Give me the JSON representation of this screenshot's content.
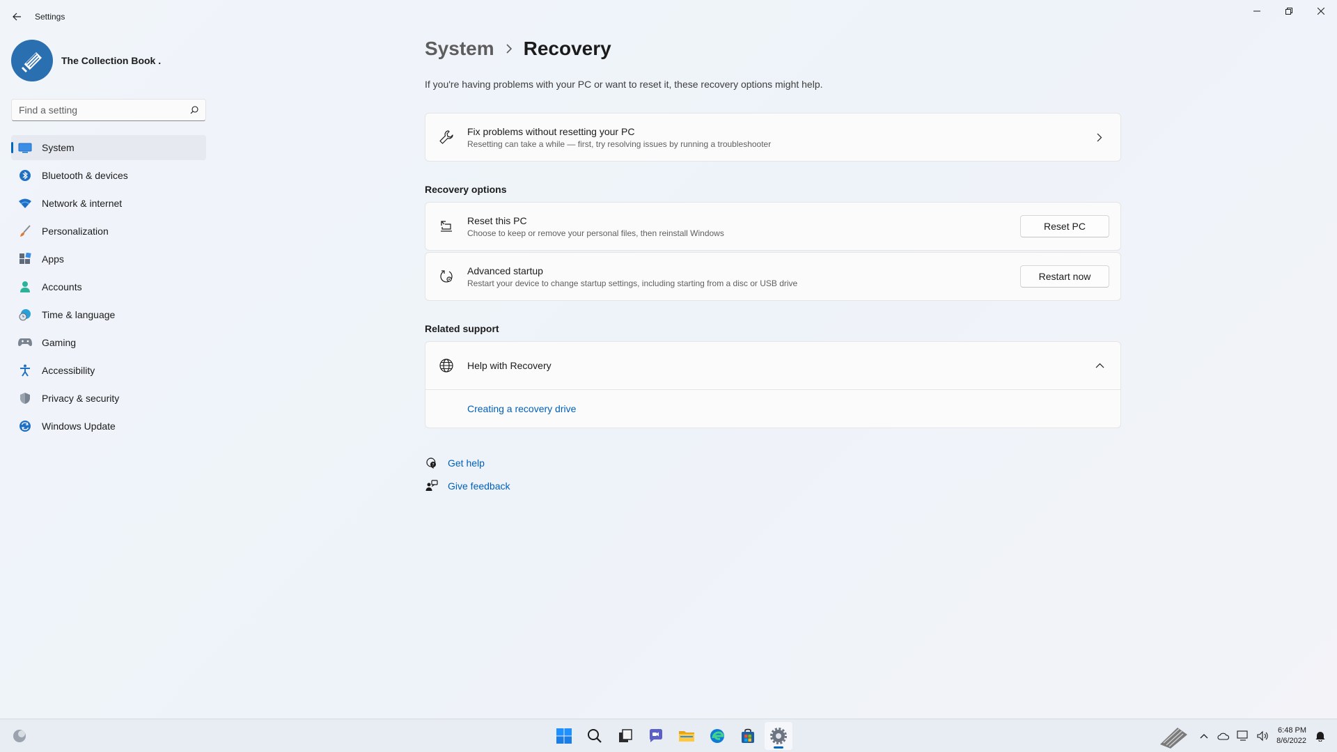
{
  "window": {
    "app_title": "Settings"
  },
  "profile": {
    "name": "The Collection Book ."
  },
  "search": {
    "placeholder": "Find a setting"
  },
  "sidebar": {
    "items": [
      {
        "label": "System",
        "icon": "system-icon",
        "active": true
      },
      {
        "label": "Bluetooth & devices",
        "icon": "bluetooth-icon"
      },
      {
        "label": "Network & internet",
        "icon": "wifi-icon"
      },
      {
        "label": "Personalization",
        "icon": "brush-icon"
      },
      {
        "label": "Apps",
        "icon": "apps-icon"
      },
      {
        "label": "Accounts",
        "icon": "accounts-icon"
      },
      {
        "label": "Time & language",
        "icon": "clock-globe-icon"
      },
      {
        "label": "Gaming",
        "icon": "gamepad-icon"
      },
      {
        "label": "Accessibility",
        "icon": "accessibility-icon"
      },
      {
        "label": "Privacy & security",
        "icon": "shield-icon"
      },
      {
        "label": "Windows Update",
        "icon": "update-icon"
      }
    ]
  },
  "breadcrumb": {
    "parent": "System",
    "current": "Recovery"
  },
  "main": {
    "subtitle": "If you're having problems with your PC or want to reset it, these recovery options might help.",
    "fix_card": {
      "title": "Fix problems without resetting your PC",
      "description": "Resetting can take a while — first, try resolving issues by running a troubleshooter",
      "icon": "wrench-icon"
    },
    "recovery_options": {
      "heading": "Recovery options",
      "reset": {
        "title": "Reset this PC",
        "description": "Choose to keep or remove your personal files, then reinstall Windows",
        "button": "Reset PC",
        "icon": "reset-pc-icon"
      },
      "advanced": {
        "title": "Advanced startup",
        "description": "Restart your device to change startup settings, including starting from a disc or USB drive",
        "button": "Restart now",
        "icon": "advanced-startup-icon"
      }
    },
    "related_support": {
      "heading": "Related support",
      "expander_title": "Help with Recovery",
      "link": "Creating a recovery drive",
      "icon": "globe-icon"
    },
    "help": {
      "get_help": "Get help",
      "give_feedback": "Give feedback"
    }
  },
  "taskbar": {
    "time": "6:48 PM",
    "date": "8/6/2022",
    "apps": [
      "start-icon",
      "search-icon",
      "task-view-icon",
      "chat-icon",
      "file-explorer-icon",
      "edge-icon",
      "store-icon",
      "settings-icon"
    ]
  },
  "colors": {
    "accent": "#0067c0",
    "link": "#005fb8",
    "background": "#eef3f9"
  }
}
